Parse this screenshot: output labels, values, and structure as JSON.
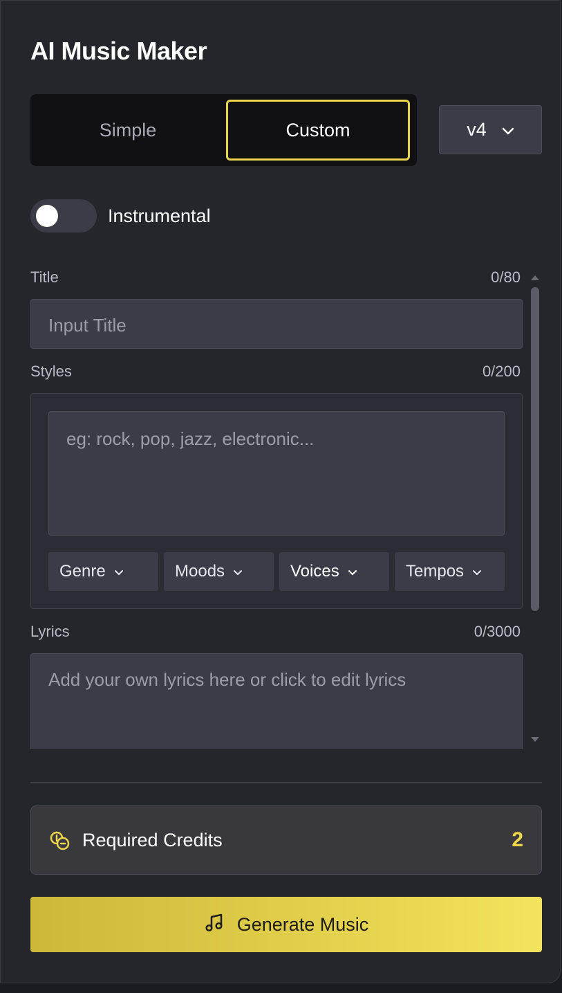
{
  "header": {
    "title": "AI Music Maker"
  },
  "mode": {
    "simple_label": "Simple",
    "custom_label": "Custom",
    "selected": "Custom"
  },
  "version": {
    "value": "v4"
  },
  "instrumental": {
    "label": "Instrumental",
    "enabled": false
  },
  "title_field": {
    "label": "Title",
    "counter": "0/80",
    "placeholder": "Input Title"
  },
  "styles_field": {
    "label": "Styles",
    "counter": "0/200",
    "placeholder": "eg: rock, pop, jazz, electronic...",
    "chips": [
      "Genre",
      "Moods",
      "Voices",
      "Tempos"
    ]
  },
  "lyrics_field": {
    "label": "Lyrics",
    "counter": "0/3000",
    "placeholder": "Add your own lyrics here or click to edit lyrics"
  },
  "credits": {
    "label": "Required Credits",
    "value": "2",
    "icon": "coins-icon"
  },
  "generate": {
    "label": "Generate Music",
    "icon": "music-note-icon"
  },
  "colors": {
    "accent": "#e8d44d",
    "panel": "#25262c",
    "input": "#3b3c47"
  }
}
